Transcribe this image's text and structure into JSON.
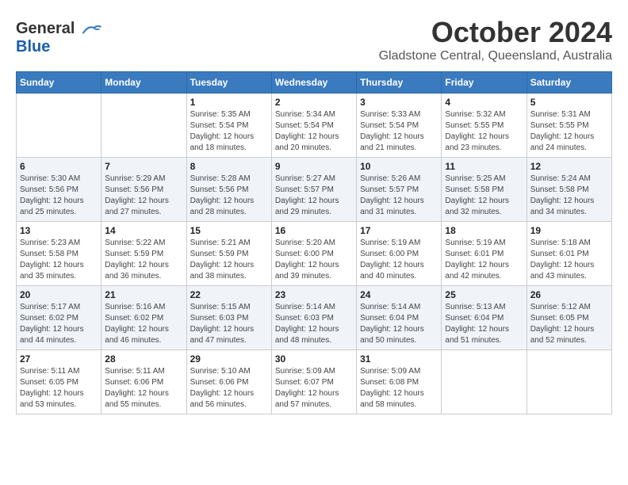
{
  "header": {
    "logo_general": "General",
    "logo_blue": "Blue",
    "month": "October 2024",
    "location": "Gladstone Central, Queensland, Australia"
  },
  "calendar": {
    "weekdays": [
      "Sunday",
      "Monday",
      "Tuesday",
      "Wednesday",
      "Thursday",
      "Friday",
      "Saturday"
    ],
    "weeks": [
      [
        {
          "day": null,
          "info": null
        },
        {
          "day": null,
          "info": null
        },
        {
          "day": "1",
          "sunrise": "5:35 AM",
          "sunset": "5:54 PM",
          "daylight": "12 hours and 18 minutes."
        },
        {
          "day": "2",
          "sunrise": "5:34 AM",
          "sunset": "5:54 PM",
          "daylight": "12 hours and 20 minutes."
        },
        {
          "day": "3",
          "sunrise": "5:33 AM",
          "sunset": "5:54 PM",
          "daylight": "12 hours and 21 minutes."
        },
        {
          "day": "4",
          "sunrise": "5:32 AM",
          "sunset": "5:55 PM",
          "daylight": "12 hours and 23 minutes."
        },
        {
          "day": "5",
          "sunrise": "5:31 AM",
          "sunset": "5:55 PM",
          "daylight": "12 hours and 24 minutes."
        }
      ],
      [
        {
          "day": "6",
          "sunrise": "5:30 AM",
          "sunset": "5:56 PM",
          "daylight": "12 hours and 25 minutes."
        },
        {
          "day": "7",
          "sunrise": "5:29 AM",
          "sunset": "5:56 PM",
          "daylight": "12 hours and 27 minutes."
        },
        {
          "day": "8",
          "sunrise": "5:28 AM",
          "sunset": "5:56 PM",
          "daylight": "12 hours and 28 minutes."
        },
        {
          "day": "9",
          "sunrise": "5:27 AM",
          "sunset": "5:57 PM",
          "daylight": "12 hours and 29 minutes."
        },
        {
          "day": "10",
          "sunrise": "5:26 AM",
          "sunset": "5:57 PM",
          "daylight": "12 hours and 31 minutes."
        },
        {
          "day": "11",
          "sunrise": "5:25 AM",
          "sunset": "5:58 PM",
          "daylight": "12 hours and 32 minutes."
        },
        {
          "day": "12",
          "sunrise": "5:24 AM",
          "sunset": "5:58 PM",
          "daylight": "12 hours and 34 minutes."
        }
      ],
      [
        {
          "day": "13",
          "sunrise": "5:23 AM",
          "sunset": "5:58 PM",
          "daylight": "12 hours and 35 minutes."
        },
        {
          "day": "14",
          "sunrise": "5:22 AM",
          "sunset": "5:59 PM",
          "daylight": "12 hours and 36 minutes."
        },
        {
          "day": "15",
          "sunrise": "5:21 AM",
          "sunset": "5:59 PM",
          "daylight": "12 hours and 38 minutes."
        },
        {
          "day": "16",
          "sunrise": "5:20 AM",
          "sunset": "6:00 PM",
          "daylight": "12 hours and 39 minutes."
        },
        {
          "day": "17",
          "sunrise": "5:19 AM",
          "sunset": "6:00 PM",
          "daylight": "12 hours and 40 minutes."
        },
        {
          "day": "18",
          "sunrise": "5:19 AM",
          "sunset": "6:01 PM",
          "daylight": "12 hours and 42 minutes."
        },
        {
          "day": "19",
          "sunrise": "5:18 AM",
          "sunset": "6:01 PM",
          "daylight": "12 hours and 43 minutes."
        }
      ],
      [
        {
          "day": "20",
          "sunrise": "5:17 AM",
          "sunset": "6:02 PM",
          "daylight": "12 hours and 44 minutes."
        },
        {
          "day": "21",
          "sunrise": "5:16 AM",
          "sunset": "6:02 PM",
          "daylight": "12 hours and 46 minutes."
        },
        {
          "day": "22",
          "sunrise": "5:15 AM",
          "sunset": "6:03 PM",
          "daylight": "12 hours and 47 minutes."
        },
        {
          "day": "23",
          "sunrise": "5:14 AM",
          "sunset": "6:03 PM",
          "daylight": "12 hours and 48 minutes."
        },
        {
          "day": "24",
          "sunrise": "5:14 AM",
          "sunset": "6:04 PM",
          "daylight": "12 hours and 50 minutes."
        },
        {
          "day": "25",
          "sunrise": "5:13 AM",
          "sunset": "6:04 PM",
          "daylight": "12 hours and 51 minutes."
        },
        {
          "day": "26",
          "sunrise": "5:12 AM",
          "sunset": "6:05 PM",
          "daylight": "12 hours and 52 minutes."
        }
      ],
      [
        {
          "day": "27",
          "sunrise": "5:11 AM",
          "sunset": "6:05 PM",
          "daylight": "12 hours and 53 minutes."
        },
        {
          "day": "28",
          "sunrise": "5:11 AM",
          "sunset": "6:06 PM",
          "daylight": "12 hours and 55 minutes."
        },
        {
          "day": "29",
          "sunrise": "5:10 AM",
          "sunset": "6:06 PM",
          "daylight": "12 hours and 56 minutes."
        },
        {
          "day": "30",
          "sunrise": "5:09 AM",
          "sunset": "6:07 PM",
          "daylight": "12 hours and 57 minutes."
        },
        {
          "day": "31",
          "sunrise": "5:09 AM",
          "sunset": "6:08 PM",
          "daylight": "12 hours and 58 minutes."
        },
        {
          "day": null,
          "info": null
        },
        {
          "day": null,
          "info": null
        }
      ]
    ],
    "labels": {
      "sunrise": "Sunrise:",
      "sunset": "Sunset:",
      "daylight": "Daylight:"
    }
  }
}
